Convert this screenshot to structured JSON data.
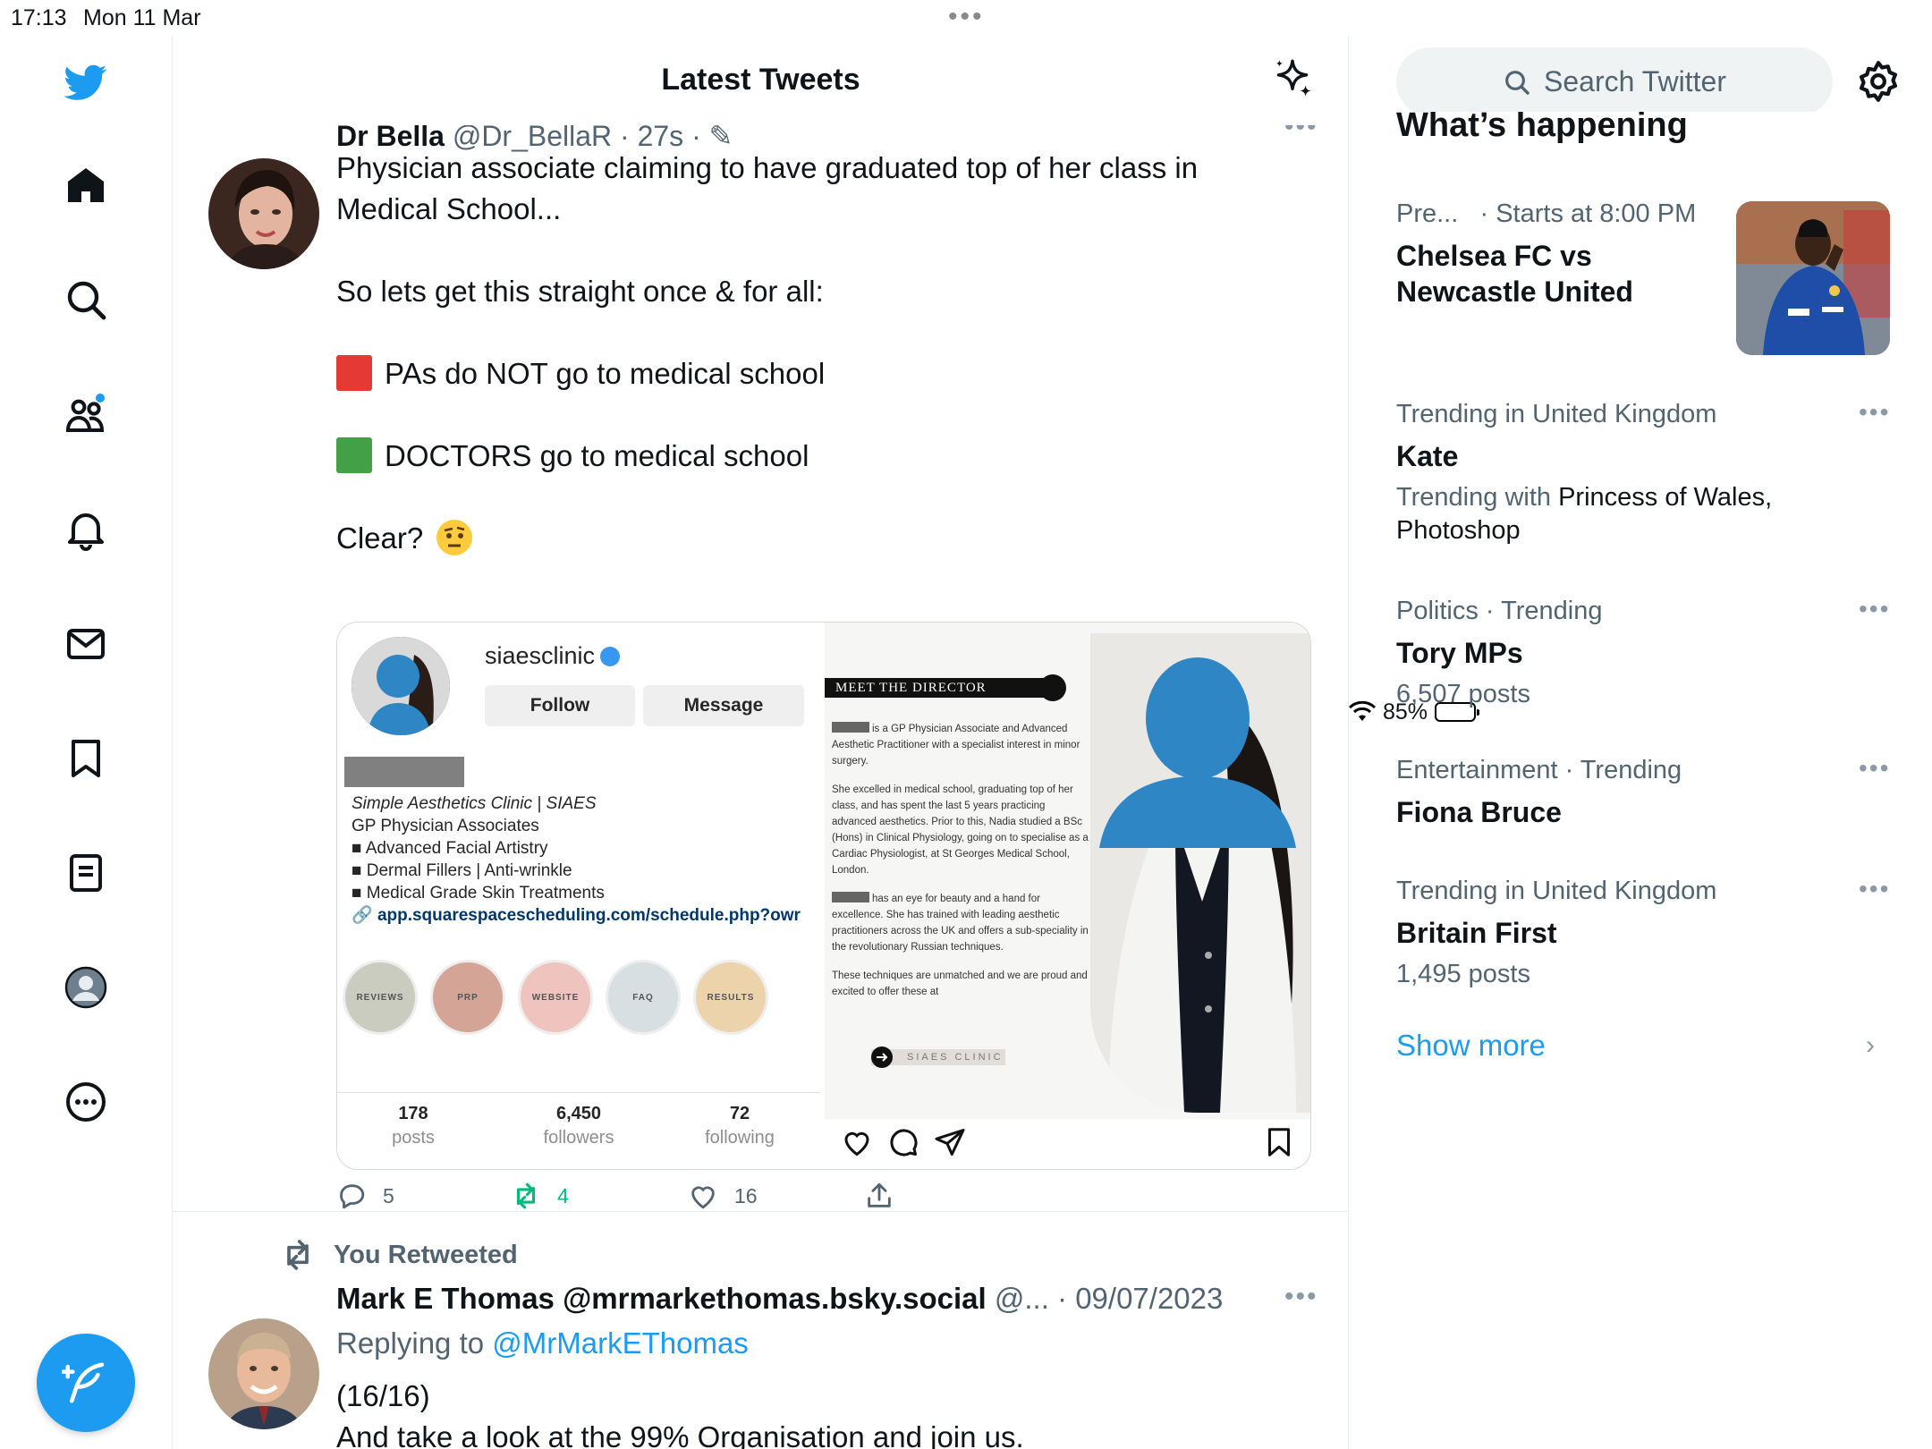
{
  "status": {
    "time": "17:13",
    "date": "Mon 11 Mar",
    "battery": "85%"
  },
  "nav": {
    "items": [
      "home",
      "explore",
      "communities",
      "notifications",
      "messages",
      "bookmarks",
      "lists",
      "profile",
      "more"
    ]
  },
  "header": {
    "title": "Latest Tweets"
  },
  "tweet1": {
    "name": "Dr Bella",
    "handle": "@Dr_BellaR · 27s ·",
    "lines": [
      "Physician associate claiming to have graduated top of her class in Medical School...",
      "So lets get this straight once & for all:",
      "PAs do NOT go to medical school",
      "DOCTORS go to medical school",
      "Clear?"
    ],
    "counts": {
      "replies": "5",
      "retweets": "4",
      "likes": "16"
    }
  },
  "media": {
    "username": "siaesclinic",
    "follow": "Follow",
    "message": "Message",
    "bio": [
      "Simple Aesthetics Clinic | SIAES",
      "GP Physician Associates",
      "Advanced Facial Artistry",
      "Dermal Fillers | Anti-wrinkle",
      "Medical Grade Skin Treatments",
      "app.squarespacescheduling.com/schedule.php?owr"
    ],
    "highlights": [
      "REVIEWS",
      "PRP",
      "WEBSITE",
      "FAQ",
      "RESULTS"
    ],
    "stats": [
      {
        "n": "178",
        "l": "posts"
      },
      {
        "n": "6,450",
        "l": "followers"
      },
      {
        "n": "72",
        "l": "following"
      }
    ],
    "meet_title": "MEET THE DIRECTOR",
    "director_paragraphs": [
      "is a GP Physician Associate and Advanced Aesthetic Practitioner with a specialist interest in minor surgery.",
      "She excelled in medical school, graduating top of her class, and has spent the last 5 years practicing advanced aesthetics. Prior to this, Nadia studied a BSc (Hons) in Clinical Physiology, going on to specialise as a Cardiac Physiologist, at St Georges Medical School, London.",
      "has an eye for beauty and a hand for excellence. She has trained with leading aesthetic practitioners across the UK and offers a sub-speciality in the revolutionary Russian techniques.",
      "These techniques are unmatched and we are proud and excited to offer these at"
    ],
    "siaes_tag": "SIAES CLINIC"
  },
  "tweet2": {
    "retweeted": "You Retweeted",
    "name": "Mark E Thomas @mrmarkethomas.bsky.social",
    "handle": " @... · 09/07/2023",
    "replying_prefix": "Replying to ",
    "replying_to": "@MrMarkEThomas",
    "line1": "(16/16)",
    "line2": "And take a look at the 99% Organisation and join us."
  },
  "sidebar": {
    "search_placeholder": "Search Twitter",
    "whats_happening": "What’s happening",
    "event": {
      "meta_a": "Pre...",
      "meta_b": "· Starts at 8:00 PM",
      "title": "Chelsea FC vs Newcastle United"
    },
    "trends": [
      {
        "meta": "Trending in United Kingdom",
        "title": "Kate",
        "sub_prefix": "Trending with ",
        "sub_main": "Princess of Wales, Photoshop"
      },
      {
        "meta": "Politics · Trending",
        "title": "Tory MPs",
        "sub": "6,507 posts"
      },
      {
        "meta": "Entertainment · Trending",
        "title": "Fiona Bruce"
      },
      {
        "meta": "Trending in United Kingdom",
        "title": "Britain First",
        "sub": "1,495 posts"
      }
    ],
    "show_more": "Show more"
  },
  "colors": {
    "accent": "#1d9bf0",
    "retweet": "#00ba7c",
    "muted": "#536471"
  }
}
